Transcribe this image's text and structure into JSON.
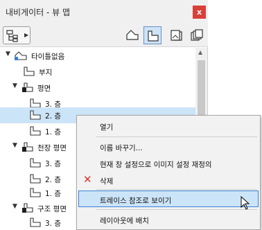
{
  "window": {
    "title": "내비게이터 - 뷰 맵",
    "close_label": "x"
  },
  "toolbar": {
    "buttons": [
      {
        "icon": "project-map-icon",
        "active": false
      },
      {
        "icon": "view-map-icon",
        "active": true
      },
      {
        "icon": "layout-book-icon",
        "active": false
      },
      {
        "icon": "publisher-sets-icon",
        "active": false
      }
    ]
  },
  "tree": {
    "root": "타이틀없음",
    "items": [
      {
        "label": "부지",
        "type": "view"
      },
      {
        "label": "평면",
        "type": "folder"
      },
      {
        "label": "3. 층",
        "type": "view"
      },
      {
        "label": "2. 층",
        "type": "view",
        "selected": true
      },
      {
        "label": "1. 층",
        "type": "view"
      },
      {
        "label": "천장 평면",
        "type": "folder"
      },
      {
        "label": "3. 층",
        "type": "view"
      },
      {
        "label": "2. 층",
        "type": "view"
      },
      {
        "label": "1. 층",
        "type": "view"
      },
      {
        "label": "구조 평면",
        "type": "folder"
      },
      {
        "label": "3. 층",
        "type": "view"
      }
    ]
  },
  "context_menu": {
    "items": [
      {
        "label": "열기"
      },
      {
        "label": "이름 바꾸기..."
      },
      {
        "label": "현재 창 설정으로 이미지 설정 재정의"
      },
      {
        "label": "삭제",
        "icon": "delete-x-icon"
      },
      {
        "label": "트레이스 참조로 보이기",
        "highlighted": true
      },
      {
        "label": "레이아웃에 배치"
      }
    ]
  },
  "colors": {
    "accent": "#3d7fd6",
    "selection": "#cce4f7",
    "close": "#d9403a",
    "delete": "#e0322b"
  }
}
